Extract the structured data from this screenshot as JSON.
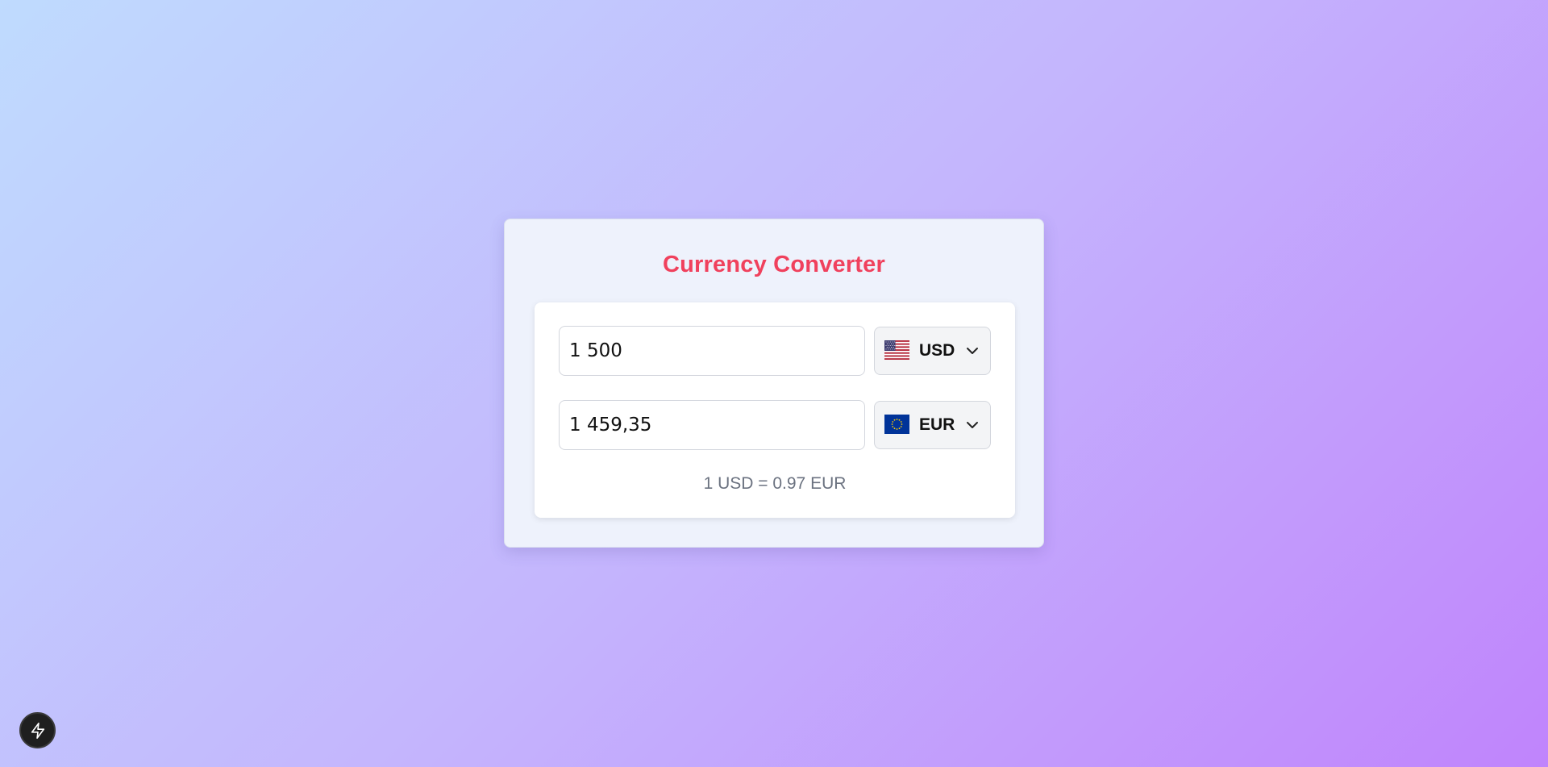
{
  "title": "Currency Converter",
  "from": {
    "amount": "1 500",
    "currency": "USD",
    "flag_icon": "us-flag-icon"
  },
  "to": {
    "amount": "1 459,35",
    "currency": "EUR",
    "flag_icon": "eu-flag-icon"
  },
  "rate_text": "1 USD = 0.97 EUR",
  "colors": {
    "title": "#f0415d",
    "card_bg": "#eef2fc",
    "background_gradient": [
      "#bfdbfe",
      "#c4b5fd",
      "#c084fc"
    ]
  },
  "fab": {
    "icon": "lightning-icon"
  }
}
